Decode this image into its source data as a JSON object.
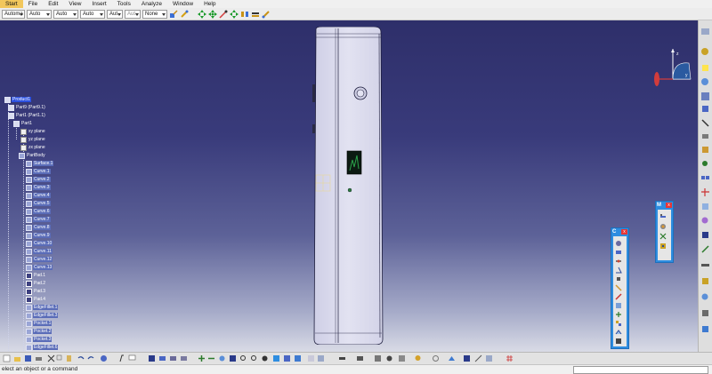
{
  "menu": [
    {
      "label": "Start",
      "active": true
    },
    {
      "label": "File"
    },
    {
      "label": "Edit"
    },
    {
      "label": "View"
    },
    {
      "label": "Insert"
    },
    {
      "label": "Tools"
    },
    {
      "label": "Analyze"
    },
    {
      "label": "Window"
    },
    {
      "label": "Help"
    }
  ],
  "toolbar": {
    "combos": [
      {
        "value": "Automa"
      },
      {
        "value": "Auto"
      },
      {
        "value": "Auto"
      },
      {
        "value": "Auto"
      },
      {
        "value": "Aut"
      },
      {
        "value": "Aut"
      },
      {
        "value": "None"
      }
    ]
  },
  "tree": {
    "root": "Product1",
    "part9": "Part9 (Part9.1)",
    "part1": "Part1 (Part1.1)",
    "part1_inner": "Part1",
    "planes": [
      "xy plane",
      "yz plane",
      "zx plane"
    ],
    "partbody": "PartBody",
    "features": [
      "Surface.1",
      "Curve.1",
      "Curve.2",
      "Curve.3",
      "Curve.4",
      "Curve.5",
      "Curve.6",
      "Curve.7",
      "Curve.8",
      "Curve.9",
      "Curve.10",
      "Curve.11",
      "Curve.12",
      "Curve.13",
      "Pad.1",
      "Pad.2",
      "Pad.3",
      "Pad.4",
      "EdgeFillet.1",
      "EdgeFillet.3",
      "Pocket.1",
      "Pocket.2",
      "Pocket.3",
      "EdgeFillet.6"
    ]
  },
  "float_toolbars": {
    "measure_title": "M",
    "constraints_title": "C",
    "close_glyph": "x"
  },
  "status": {
    "message": "elect an object or a command"
  },
  "colors": {
    "background_top": "#2e2f6a",
    "background_bottom": "#d9dbe6",
    "selection": "#2c51e0",
    "float_toolbar": "#2e8de0",
    "part_fill": "#dcdcee"
  }
}
